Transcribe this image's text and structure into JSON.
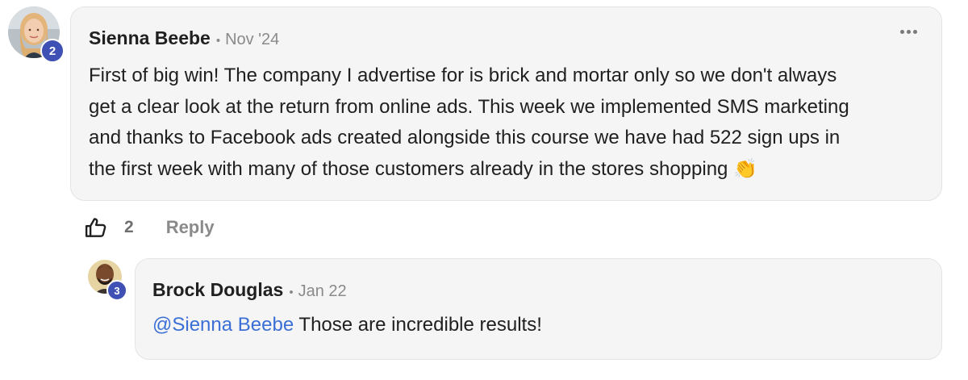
{
  "comment": {
    "author": "Sienna Beebe",
    "separator": "•",
    "date": "Nov '24",
    "level": "2",
    "body_lines": [
      "First of big win! The company I advertise for is brick and mortar only so we don't always",
      "get a clear look at the return from online ads. This week we implemented SMS marketing",
      "and thanks to Facebook ads created alongside this course we have had 522 sign ups in",
      "the first week with many of those customers already in the stores shopping 👏"
    ],
    "like_count": "2",
    "reply_label": "Reply",
    "more_icon": "more-horizontal-icon",
    "like_icon": "thumbs-up-icon"
  },
  "reply": {
    "author": "Brock Douglas",
    "separator": "•",
    "date": "Jan 22",
    "level": "3",
    "mention": "@Sienna Beebe",
    "text": " Those are incredible results!"
  },
  "colors": {
    "bubble_bg": "#f5f5f5",
    "badge": "#3f51b5",
    "mention": "#3b6fd6",
    "muted": "#8a8a8a"
  }
}
